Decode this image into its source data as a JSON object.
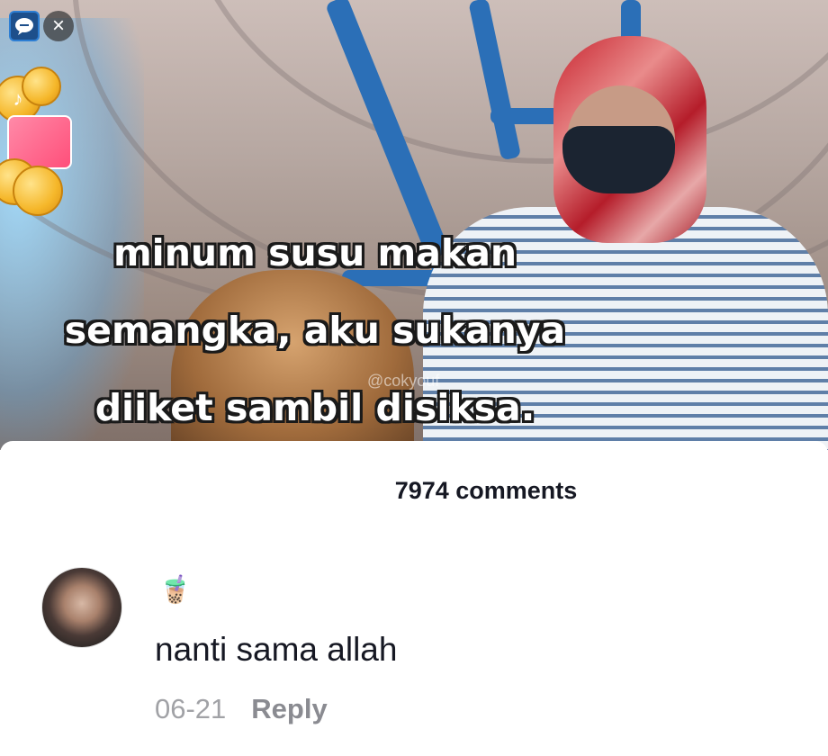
{
  "video": {
    "caption_lines": [
      "minum susu makan",
      "semangka, aku sukanya",
      "diiket sambil disiksa."
    ],
    "watermark": "@cokyouf"
  },
  "top_controls": {
    "chat_icon": "chat-bubble-icon",
    "close_icon": "close-icon",
    "close_glyph": "×"
  },
  "reward_widget": {
    "coin_icon": "tiktok-coin-icon",
    "gift_icon": "gift-box-icon",
    "coin_glyph": "♪"
  },
  "comments": {
    "count_label": "7974 comments",
    "items": [
      {
        "username": "🧋",
        "text": "nanti sama allah",
        "date": "06-21",
        "reply_label": "Reply"
      }
    ]
  },
  "colors": {
    "text_primary": "#161823",
    "text_secondary": "#a1a2a6",
    "caption_stroke": "#1a1a1a",
    "pole_blue": "#2b6fb7"
  }
}
